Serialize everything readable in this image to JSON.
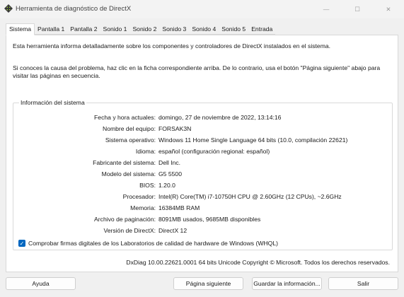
{
  "window": {
    "title": "Herramienta de diagnóstico de DirectX",
    "minimize": "—",
    "maximize": "☐",
    "close": "✕"
  },
  "tabs": [
    "Sistema",
    "Pantalla 1",
    "Pantalla 2",
    "Sonido 1",
    "Sonido 2",
    "Sonido 3",
    "Sonido 4",
    "Sonido 5",
    "Entrada"
  ],
  "main": {
    "intro1": "Esta herramienta informa detalladamente sobre los componentes y controladores de DirectX instalados en el sistema.",
    "intro2": "Si conoces la causa del problema, haz clic en la ficha correspondiente arriba. De lo contrario, usa el botón \"Página siguiente\" abajo para visitar las páginas en secuencia.",
    "group_title": "Información del sistema",
    "info": [
      {
        "label": "Fecha y hora actuales:",
        "value": "domingo, 27 de noviembre de 2022, 13:14:16"
      },
      {
        "label": "Nombre del equipo:",
        "value": "FORSAK3N"
      },
      {
        "label": "Sistema operativo:",
        "value": "Windows 11 Home Single Language 64 bits (10.0, compilación 22621)"
      },
      {
        "label": "Idioma:",
        "value": "español (configuración regional: español)"
      },
      {
        "label": "Fabricante del sistema:",
        "value": "Dell Inc."
      },
      {
        "label": "Modelo del sistema:",
        "value": "G5 5500"
      },
      {
        "label": "BIOS:",
        "value": "1.20.0"
      },
      {
        "label": "Procesador:",
        "value": "Intel(R) Core(TM) i7-10750H CPU @ 2.60GHz (12 CPUs), ~2.6GHz"
      },
      {
        "label": "Memoria:",
        "value": "16384MB RAM"
      },
      {
        "label": "Archivo de paginación:",
        "value": "8091MB usados, 9685MB disponibles"
      },
      {
        "label": "Versión de DirectX:",
        "value": "DirectX 12"
      }
    ],
    "whql_label": "Comprobar firmas digitales de los Laboratorios de calidad de hardware de Windows (WHQL)",
    "whql_checked": true,
    "copyright": "DxDiag 10.00.22621.0001 64 bits Unicode  Copyright © Microsoft. Todos los derechos reservados."
  },
  "buttons": {
    "help": "Ayuda",
    "next": "Página siguiente",
    "save": "Guardar la información...",
    "exit": "Salir"
  },
  "colors": {
    "accent": "#0067c0"
  }
}
